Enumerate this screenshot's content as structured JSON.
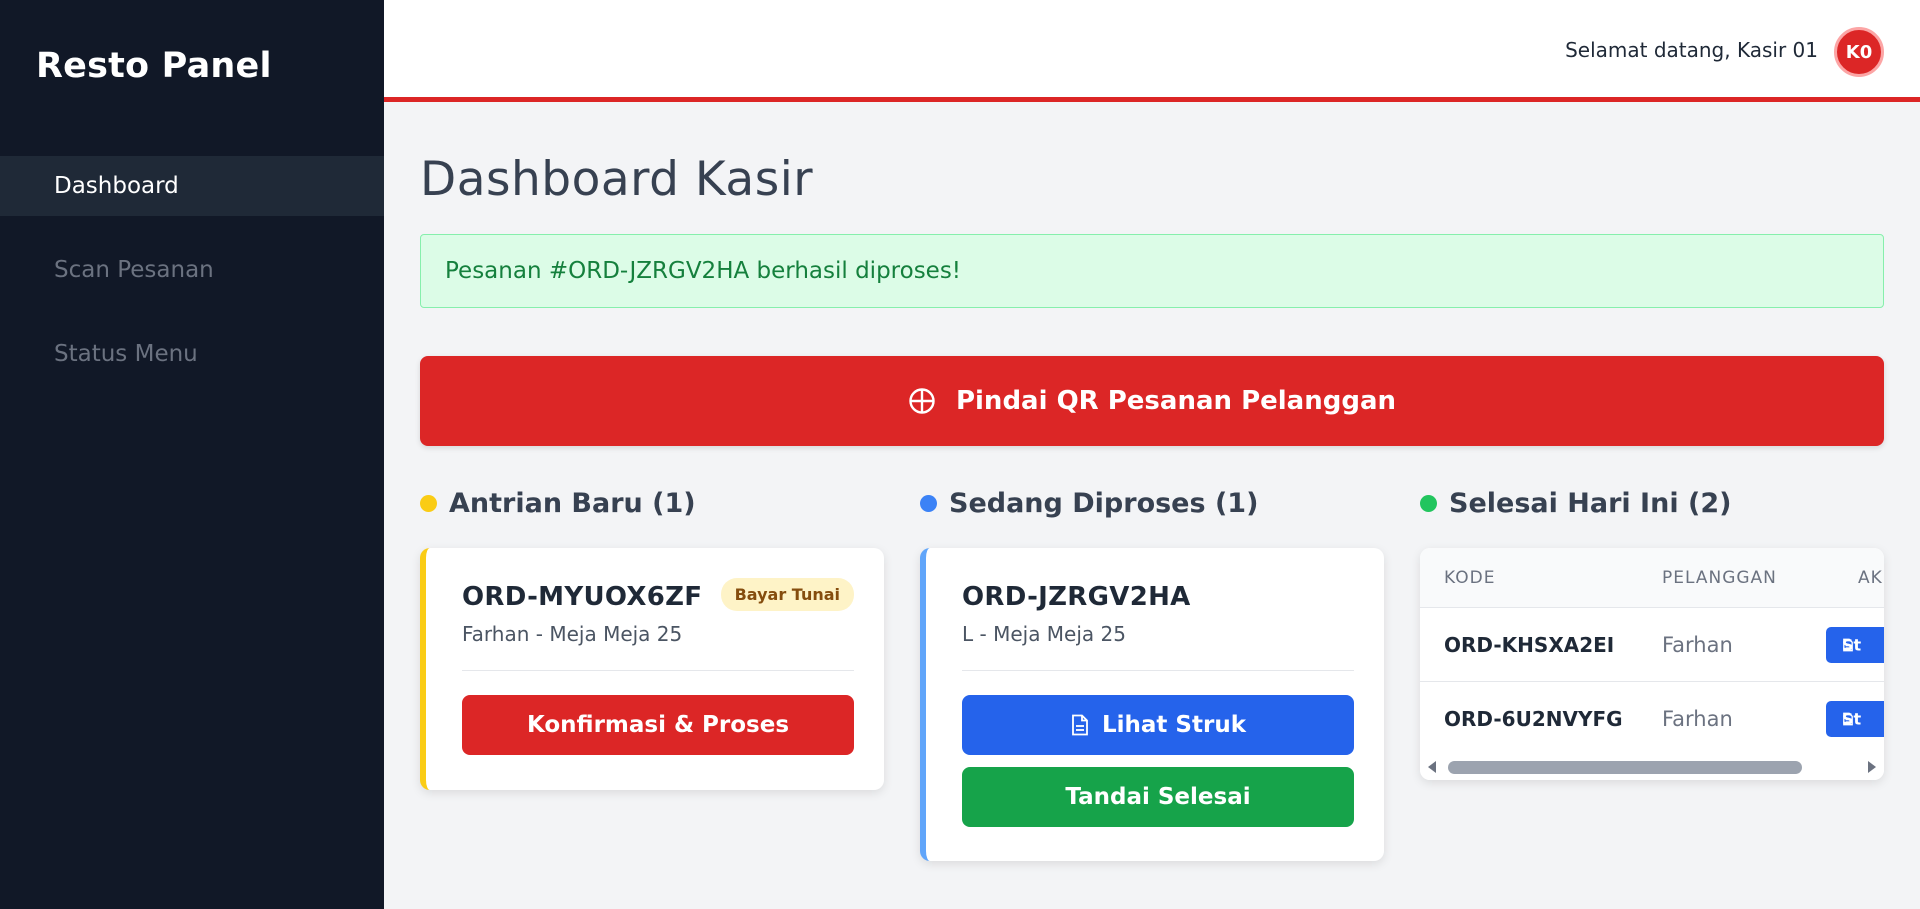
{
  "sidebar": {
    "brand": "Resto Panel",
    "items": [
      {
        "label": "Dashboard",
        "active": true
      },
      {
        "label": "Scan Pesanan",
        "active": false
      },
      {
        "label": "Status Menu",
        "active": false
      }
    ]
  },
  "header": {
    "welcome": "Selamat datang, Kasir 01",
    "avatar_initials": "K0",
    "accent_color": "#dc2626"
  },
  "main": {
    "title": "Dashboard Kasir",
    "alert": "Pesanan #ORD-JZRGV2HA berhasil diproses!",
    "scan_button": {
      "label": "Pindai QR Pesanan Pelanggan",
      "icon": "crosshair-icon"
    }
  },
  "columns": {
    "queue": {
      "title": "Antrian Baru (1)",
      "dot_color": "#facc15",
      "order": {
        "code": "ORD-MYUOX6ZF",
        "customer": "Farhan - Meja Meja 25",
        "badge": "Bayar Tunai",
        "action": "Konfirmasi & Proses"
      }
    },
    "processing": {
      "title": "Sedang Diproses (1)",
      "dot_color": "#3b82f6",
      "order": {
        "code": "ORD-JZRGV2HA",
        "customer": "L - Meja Meja 25",
        "receipt_button": "Lihat Struk",
        "done_button": "Tandai Selesai"
      }
    },
    "done": {
      "title": "Selesai Hari Ini (2)",
      "dot_color": "#22c55e",
      "table": {
        "headers": [
          "KODE",
          "PELANGGAN",
          "AK"
        ],
        "rows": [
          {
            "code": "ORD-KHSXA2EI",
            "customer": "Farhan",
            "action": "St"
          },
          {
            "code": "ORD-6U2NVYFG",
            "customer": "Farhan",
            "action": "St"
          }
        ]
      }
    }
  }
}
